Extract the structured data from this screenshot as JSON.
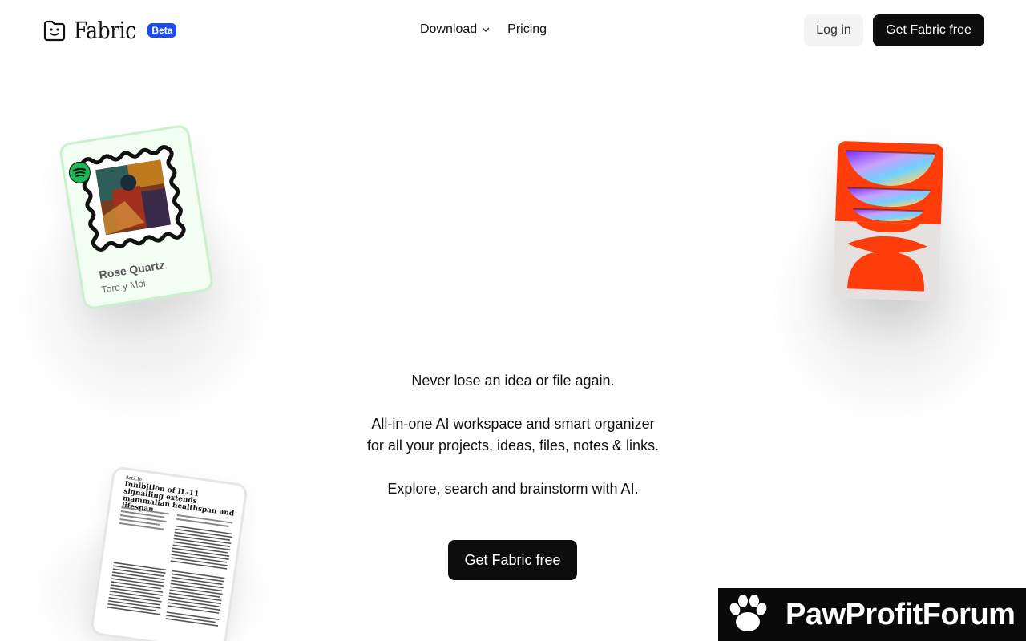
{
  "brand": {
    "name": "Fabric",
    "badge": "Beta"
  },
  "nav": {
    "download": "Download",
    "pricing": "Pricing"
  },
  "header": {
    "login": "Log in",
    "cta": "Get Fabric free"
  },
  "hero": {
    "line1": "Never lose an idea or file again.",
    "line2": "All-in-one AI workspace and smart organizer",
    "line3": "for all your projects, ideas, files, notes & links.",
    "line4": "Explore, search and brainstorm with AI.",
    "cta": "Get Fabric free"
  },
  "cards": {
    "spotify": {
      "title": "Rose Quartz",
      "subtitle": "Toro y Moi"
    },
    "paper": {
      "label": "Article",
      "title": "Inhibition of IL-11 signalling extends mammalian healthspan and lifespan"
    }
  },
  "watermark": {
    "text": "PawProfitForum"
  },
  "colors": {
    "accent": "#1f4cf0",
    "cta": "#0d0d0d",
    "spotify": "#1db954",
    "orange": "#ff3d0a"
  }
}
